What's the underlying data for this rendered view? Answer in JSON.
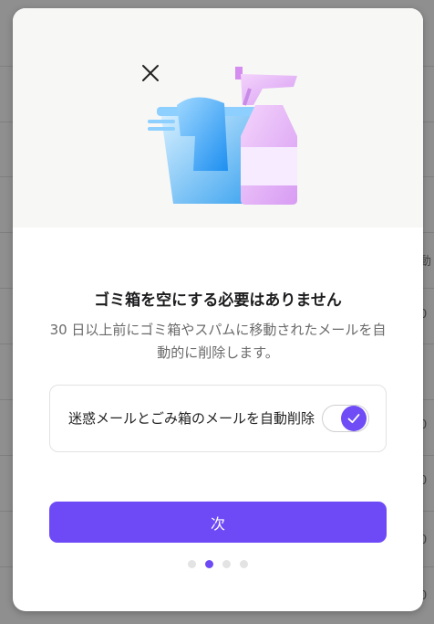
{
  "background_page": {
    "edge_chars": [
      "動",
      "0",
      "0",
      "0",
      "0",
      "0"
    ]
  },
  "modal": {
    "close_icon": "close-icon",
    "illustration": "cleaning-bucket-and-spray-illustration",
    "title": "ゴミ箱を空にする必要はありません",
    "description": "30 日以上前にゴミ箱やスパムに移動されたメールを自動的に削除します。",
    "setting": {
      "label": "迷惑メールとごみ箱のメールを自動削除",
      "enabled": true
    },
    "next_button": "次",
    "pagination": {
      "total": 4,
      "current": 2
    }
  },
  "colors": {
    "accent": "#6e4af7",
    "hero_bg": "#f7f7f5",
    "overlay": "#8f8f8f"
  }
}
